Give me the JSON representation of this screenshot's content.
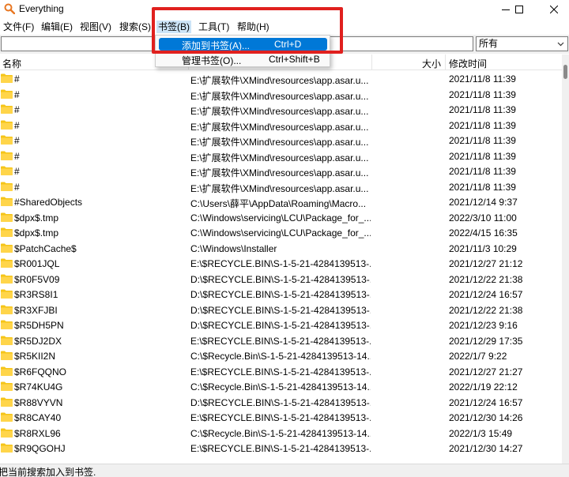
{
  "window": {
    "title": "Everything",
    "controls": [
      "minimize-icon",
      "maximize-icon",
      "close-icon"
    ]
  },
  "menubar": {
    "items": [
      "文件(F)",
      "编辑(E)",
      "视图(V)",
      "搜索(S)",
      "书签(B)",
      "工具(T)",
      "帮助(H)"
    ],
    "active_index": 4
  },
  "search": {
    "value": "",
    "filter": "所有"
  },
  "columns": {
    "name": "名称",
    "path": "",
    "size": "大小",
    "modified": "修改时间"
  },
  "bookmark_menu": {
    "items": [
      {
        "label": "添加到书签(A)...",
        "shortcut": "Ctrl+D",
        "highlighted": true
      },
      {
        "label": "管理书签(O)...",
        "shortcut": "Ctrl+Shift+B",
        "highlighted": false
      }
    ]
  },
  "rows": [
    {
      "name": "#",
      "path": "E:\\扩展软件\\XMind\\resources\\app.asar.u...",
      "date": "2021/11/8 11:39"
    },
    {
      "name": "#",
      "path": "E:\\扩展软件\\XMind\\resources\\app.asar.u...",
      "date": "2021/11/8 11:39"
    },
    {
      "name": "#",
      "path": "E:\\扩展软件\\XMind\\resources\\app.asar.u...",
      "date": "2021/11/8 11:39"
    },
    {
      "name": "#",
      "path": "E:\\扩展软件\\XMind\\resources\\app.asar.u...",
      "date": "2021/11/8 11:39"
    },
    {
      "name": "#",
      "path": "E:\\扩展软件\\XMind\\resources\\app.asar.u...",
      "date": "2021/11/8 11:39"
    },
    {
      "name": "#",
      "path": "E:\\扩展软件\\XMind\\resources\\app.asar.u...",
      "date": "2021/11/8 11:39"
    },
    {
      "name": "#",
      "path": "E:\\扩展软件\\XMind\\resources\\app.asar.u...",
      "date": "2021/11/8 11:39"
    },
    {
      "name": "#",
      "path": "E:\\扩展软件\\XMind\\resources\\app.asar.u...",
      "date": "2021/11/8 11:39"
    },
    {
      "name": "#SharedObjects",
      "path": "C:\\Users\\薛平\\AppData\\Roaming\\Macro...",
      "date": "2021/12/14 9:37"
    },
    {
      "name": "$dpx$.tmp",
      "path": "C:\\Windows\\servicing\\LCU\\Package_for_...",
      "date": "2022/3/10 11:00"
    },
    {
      "name": "$dpx$.tmp",
      "path": "C:\\Windows\\servicing\\LCU\\Package_for_...",
      "date": "2022/4/15 16:35"
    },
    {
      "name": "$PatchCache$",
      "path": "C:\\Windows\\Installer",
      "date": "2021/11/3 10:29"
    },
    {
      "name": "$R001JQL",
      "path": "E:\\$RECYCLE.BIN\\S-1-5-21-4284139513-...",
      "date": "2021/12/27 21:12"
    },
    {
      "name": "$R0F5V09",
      "path": "D:\\$RECYCLE.BIN\\S-1-5-21-4284139513-...",
      "date": "2021/12/22 21:38"
    },
    {
      "name": "$R3RS8I1",
      "path": "D:\\$RECYCLE.BIN\\S-1-5-21-4284139513-...",
      "date": "2021/12/24 16:57"
    },
    {
      "name": "$R3XFJBI",
      "path": "D:\\$RECYCLE.BIN\\S-1-5-21-4284139513-...",
      "date": "2021/12/22 21:38"
    },
    {
      "name": "$R5DH5PN",
      "path": "D:\\$RECYCLE.BIN\\S-1-5-21-4284139513-...",
      "date": "2021/12/23 9:16"
    },
    {
      "name": "$R5DJ2DX",
      "path": "E:\\$RECYCLE.BIN\\S-1-5-21-4284139513-...",
      "date": "2021/12/29 17:35"
    },
    {
      "name": "$R5KII2N",
      "path": "C:\\$Recycle.Bin\\S-1-5-21-4284139513-14...",
      "date": "2022/1/7 9:22"
    },
    {
      "name": "$R6FQQNO",
      "path": "E:\\$RECYCLE.BIN\\S-1-5-21-4284139513-...",
      "date": "2021/12/27 21:27"
    },
    {
      "name": "$R74KU4G",
      "path": "C:\\$Recycle.Bin\\S-1-5-21-4284139513-14...",
      "date": "2022/1/19 22:12"
    },
    {
      "name": "$R88VYVN",
      "path": "D:\\$RECYCLE.BIN\\S-1-5-21-4284139513-...",
      "date": "2021/12/24 16:57"
    },
    {
      "name": "$R8CAY40",
      "path": "E:\\$RECYCLE.BIN\\S-1-5-21-4284139513-...",
      "date": "2021/12/30 14:26"
    },
    {
      "name": "$R8RXL96",
      "path": "C:\\$Recycle.Bin\\S-1-5-21-4284139513-14...",
      "date": "2022/1/3 15:49"
    },
    {
      "name": "$R9QGOHJ",
      "path": "E:\\$RECYCLE.BIN\\S-1-5-21-4284139513-...",
      "date": "2021/12/30 14:27"
    }
  ],
  "status": "把当前搜索加入到书签.",
  "colors": {
    "folder": "#f5c518",
    "menu_highlight": "#0078d7",
    "annotation": "#e0201e"
  }
}
